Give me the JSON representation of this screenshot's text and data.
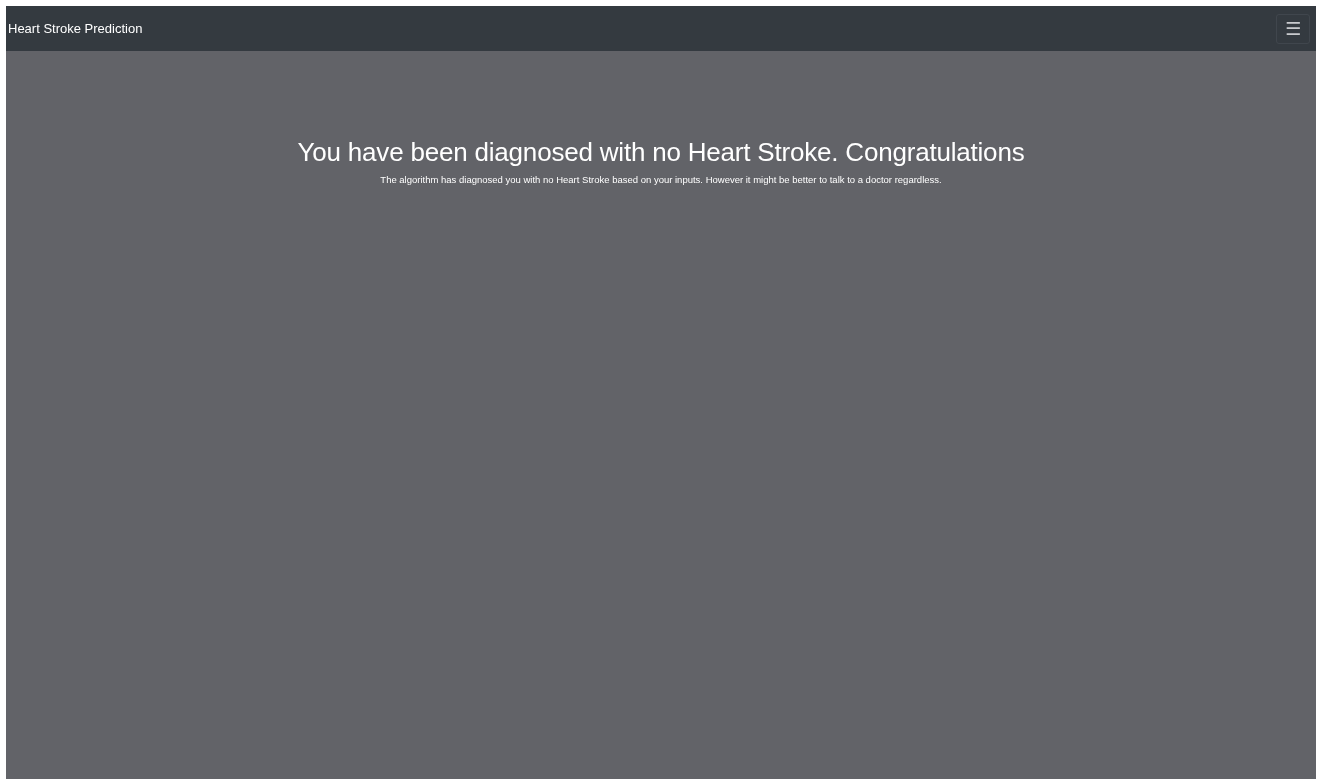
{
  "navbar": {
    "brand": "Heart Stroke Prediction",
    "menu_toggle": "☰"
  },
  "result": {
    "heading": "You have been diagnosed with no Heart Stroke. Congratulations",
    "message": "The algorithm has diagnosed you with no Heart Stroke based on your inputs. However it might be better to talk to a doctor regardless."
  }
}
